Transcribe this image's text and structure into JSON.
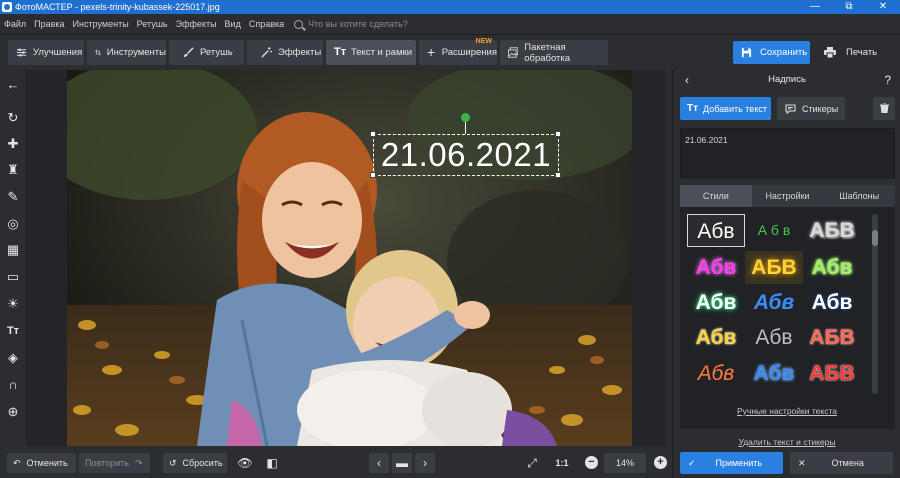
{
  "window": {
    "title": "ФотоМАСТЕР - pexels-trinity-kubassek-225017.jpg",
    "minimize": "—",
    "maximize": "⧉",
    "close": "✕"
  },
  "menu": {
    "items": [
      "Файл",
      "Правка",
      "Инструменты",
      "Ретушь",
      "Эффекты",
      "Вид",
      "Справка"
    ],
    "search_placeholder": "Что вы хотите сделать?"
  },
  "toolbar": {
    "tabs": [
      {
        "label": "Улучшения",
        "icon": "sliders-icon"
      },
      {
        "label": "Инструменты",
        "icon": "crop-icon"
      },
      {
        "label": "Ретушь",
        "icon": "brush-icon"
      },
      {
        "label": "Эффекты",
        "icon": "magic-wand-icon"
      },
      {
        "label": "Текст и рамки",
        "icon": "text-icon",
        "active": true
      },
      {
        "label": "Расширения",
        "icon": "plus-icon",
        "badge": "NEW"
      },
      {
        "label": "Пакетная обработка",
        "icon": "batch-images-icon"
      }
    ],
    "save_label": "Сохранить",
    "print_label": "Печать"
  },
  "left_tools": [
    "back-arrow-icon",
    "rotate-icon",
    "bandage-icon",
    "stamp-icon",
    "brush-icon",
    "radial-filter-icon",
    "gradient-filter-icon",
    "vignette-icon",
    "light-icon",
    "text-icon",
    "fill-icon",
    "magnet-icon",
    "target-icon"
  ],
  "canvas": {
    "overlay_text": "21.06.2021",
    "text_color": "#ffffff"
  },
  "panel": {
    "title": "Надпись",
    "back": "‹",
    "help": "?",
    "add_text_label": "Добавить текст",
    "stickers_label": "Стикеры",
    "text_value": "21.06.2021",
    "tabs": [
      {
        "label": "Стили",
        "active": true
      },
      {
        "label": "Настройки"
      },
      {
        "label": "Шаблоны"
      }
    ],
    "style_sample": "Абв",
    "styles": [
      {
        "text": "Абв",
        "color": "#ffffff",
        "selected": true
      },
      {
        "text": "А б в",
        "color": "#3ecf4a"
      },
      {
        "text": "АБВ",
        "color": "#c8c8c8"
      },
      {
        "text": "Абв",
        "color": "#ff3cf0"
      },
      {
        "text": "АБВ",
        "color": "#ffd23a"
      },
      {
        "text": "Абв",
        "color": "#9cf25a"
      },
      {
        "text": "Абв",
        "color": "#ffffff"
      },
      {
        "text": "Абв",
        "color": "#3c8cff"
      },
      {
        "text": "Абв",
        "color": "#ffffff"
      },
      {
        "text": "Абв",
        "color": "#ffd23a"
      },
      {
        "text": "Абв",
        "color": "#bfbfbf"
      },
      {
        "text": "АБВ",
        "color": "#ff6a5a"
      },
      {
        "text": "Абв",
        "color": "#ff7a3a"
      },
      {
        "text": "Абв",
        "color": "#3a8cff"
      },
      {
        "text": "АБВ",
        "color": "#ff3a3a"
      }
    ],
    "manual_settings_label": "Ручные настройки текста",
    "delete_label": "Удалить текст и стикеры"
  },
  "bottom": {
    "undo_label": "Отменить",
    "redo_label": "Повторить",
    "reset_label": "Сбросить",
    "one_to_one": "1:1",
    "zoom": "14%",
    "apply_label": "Применить",
    "cancel_label": "Отмена"
  },
  "colors": {
    "accent": "#2a80e0",
    "panel": "#2b2d31",
    "badge": "#ff9a2e"
  }
}
